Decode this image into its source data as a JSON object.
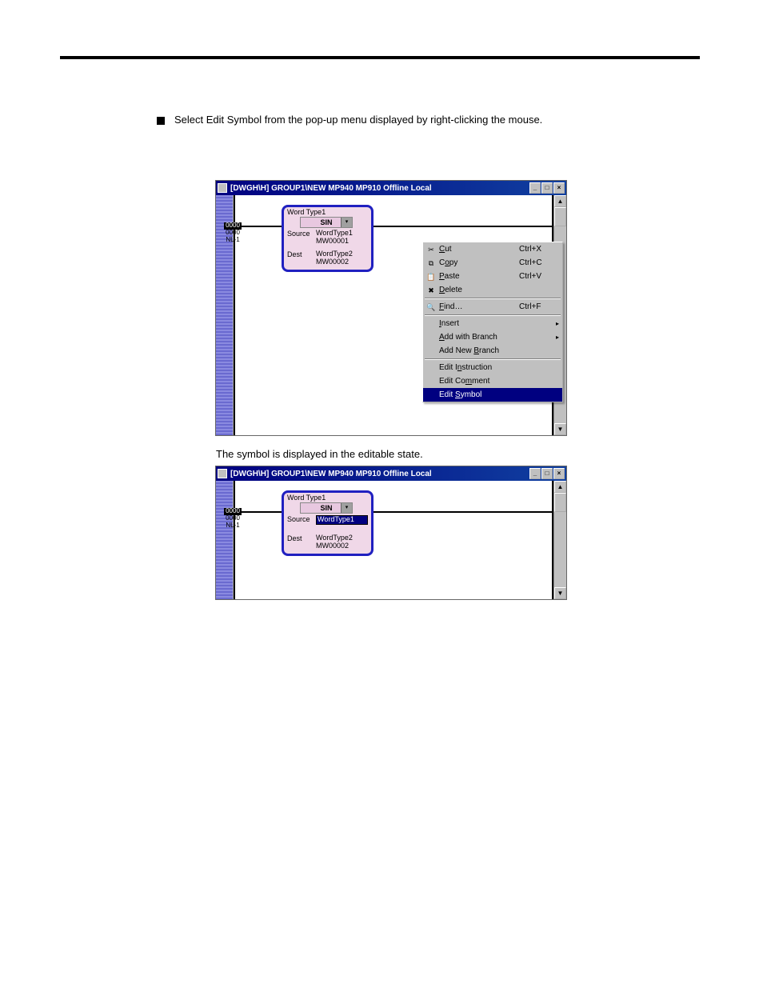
{
  "bullet": {
    "text": "Select Edit Symbol from the pop-up menu displayed by right-clicking the mouse."
  },
  "window": {
    "title": "[DWGH\\H]   GROUP1\\NEW  MP940  MP910     Offline  Local",
    "sysbuttons": {
      "min": "_",
      "max": "□",
      "close": "×"
    },
    "rung": {
      "addr": "0000",
      "sub1": "0000",
      "sub2": "NL-1"
    },
    "instr": {
      "title": "Word Type1",
      "op": "SIN",
      "source_label": "Source",
      "source_sym": "WordType1",
      "source_reg": "MW00001",
      "dest_label": "Dest",
      "dest_sym": "WordType2",
      "dest_reg": "MW00002"
    }
  },
  "ctxmenu": {
    "items": [
      {
        "icon": "cut-icon",
        "glyph": "✂",
        "label_pre": "",
        "label_u": "C",
        "label_post": "ut",
        "shortcut": "Ctrl+X",
        "sub": false
      },
      {
        "icon": "copy-icon",
        "glyph": "⧉",
        "label_pre": "C",
        "label_u": "o",
        "label_post": "py",
        "shortcut": "Ctrl+C",
        "sub": false
      },
      {
        "icon": "paste-icon",
        "glyph": "📋",
        "label_pre": "",
        "label_u": "P",
        "label_post": "aste",
        "shortcut": "Ctrl+V",
        "sub": false
      },
      {
        "icon": "delete-icon",
        "glyph": "✖",
        "label_pre": "",
        "label_u": "D",
        "label_post": "elete",
        "shortcut": "",
        "sub": false
      },
      {
        "sep": true
      },
      {
        "icon": "find-icon",
        "glyph": "🔍",
        "label_pre": "",
        "label_u": "F",
        "label_post": "ind…",
        "shortcut": "Ctrl+F",
        "sub": false
      },
      {
        "sep": true
      },
      {
        "icon": "",
        "glyph": "",
        "label_pre": "",
        "label_u": "I",
        "label_post": "nsert",
        "shortcut": "",
        "sub": true
      },
      {
        "icon": "",
        "glyph": "",
        "label_pre": "",
        "label_u": "A",
        "label_post": "dd with Branch",
        "shortcut": "",
        "sub": true
      },
      {
        "icon": "",
        "glyph": "",
        "label_pre": "Add New ",
        "label_u": "B",
        "label_post": "ranch",
        "shortcut": "",
        "sub": false
      },
      {
        "sep": true
      },
      {
        "icon": "",
        "glyph": "",
        "label_pre": "Edit I",
        "label_u": "n",
        "label_post": "struction",
        "shortcut": "",
        "sub": false
      },
      {
        "icon": "",
        "glyph": "",
        "label_pre": "Edit Co",
        "label_u": "m",
        "label_post": "ment",
        "shortcut": "",
        "sub": false
      },
      {
        "icon": "",
        "glyph": "",
        "label_pre": "Edit ",
        "label_u": "S",
        "label_post": "ymbol",
        "shortcut": "",
        "sub": false,
        "selected": true
      }
    ]
  },
  "caption2": "The symbol is displayed in the editable state."
}
